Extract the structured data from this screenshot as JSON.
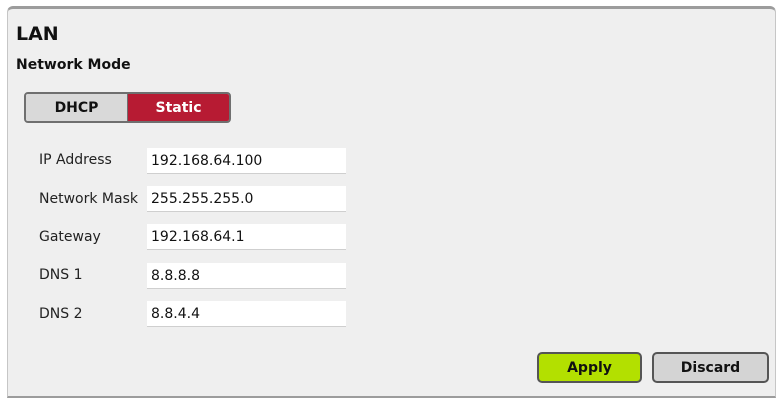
{
  "panel": {
    "title": "LAN",
    "network_mode_label": "Network Mode"
  },
  "network_mode": {
    "options": [
      "DHCP",
      "Static"
    ],
    "selected": "Static"
  },
  "fields": {
    "ip_address": {
      "label": "IP Address",
      "value": "192.168.64.100"
    },
    "network_mask": {
      "label": "Network Mask",
      "value": "255.255.255.0"
    },
    "gateway": {
      "label": "Gateway",
      "value": "192.168.64.1"
    },
    "dns1": {
      "label": "DNS 1",
      "value": "8.8.8.8"
    },
    "dns2": {
      "label": "DNS 2",
      "value": "8.8.4.4"
    }
  },
  "actions": {
    "apply_label": "Apply",
    "discard_label": "Discard"
  },
  "colors": {
    "selected_mode": "#b71b33",
    "apply_button": "#b3e000"
  }
}
